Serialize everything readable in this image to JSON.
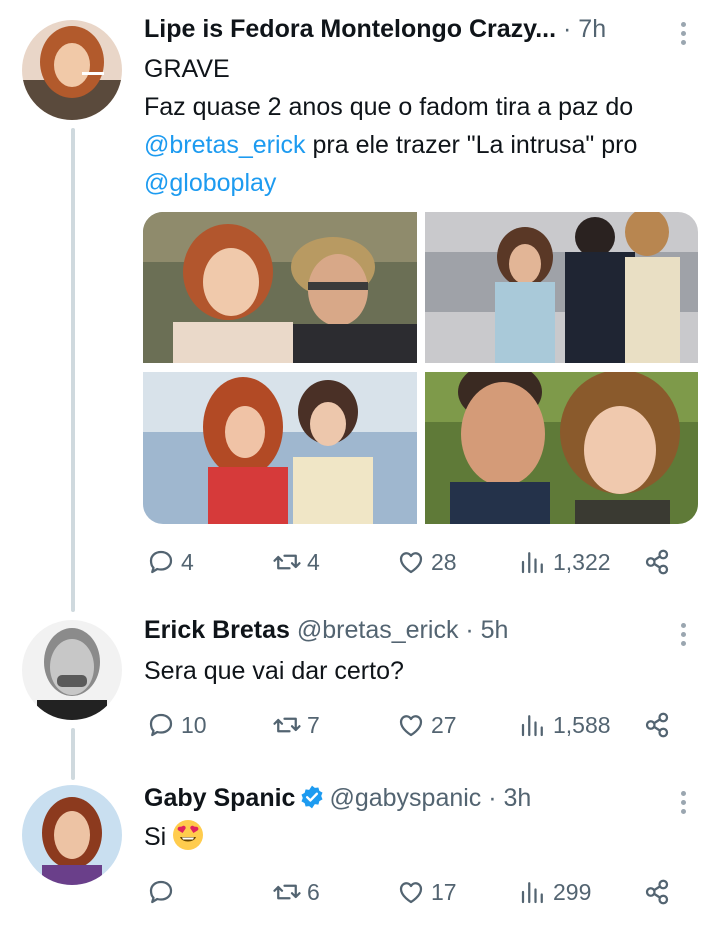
{
  "tweets": [
    {
      "name": "Lipe is Fedora Montelongo Crazy...",
      "time": "· 7h",
      "lines": [
        "GRAVE",
        "Faz quase 2 anos que o fadom tira a paz do"
      ],
      "mention1": "@bretas_erick",
      "line3_rest": " pra ele trazer \"La intrusa\" pro",
      "mention2": "@globoplay",
      "stats": {
        "replies": "4",
        "retweets": "4",
        "likes": "28",
        "views": "1,322"
      }
    },
    {
      "name": "Erick Bretas",
      "handle": "@bretas_erick · 5h",
      "text": "Sera que vai dar certo?",
      "stats": {
        "replies": "10",
        "retweets": "7",
        "likes": "27",
        "views": "1,588"
      }
    },
    {
      "name": "Gaby Spanic",
      "handle": "@gabyspanic · 3h",
      "text": "Si",
      "stats": {
        "replies": "",
        "retweets": "6",
        "likes": "17",
        "views": "299"
      }
    }
  ],
  "colors": {
    "link": "#1d9bf0",
    "muted": "#536471",
    "thread": "#cfd9de",
    "verified": "#1d9bf0"
  },
  "icons": [
    "reply-icon",
    "retweet-icon",
    "like-icon",
    "views-icon",
    "share-icon",
    "more-icon",
    "verified-icon",
    "heart-eyes-emoji"
  ]
}
